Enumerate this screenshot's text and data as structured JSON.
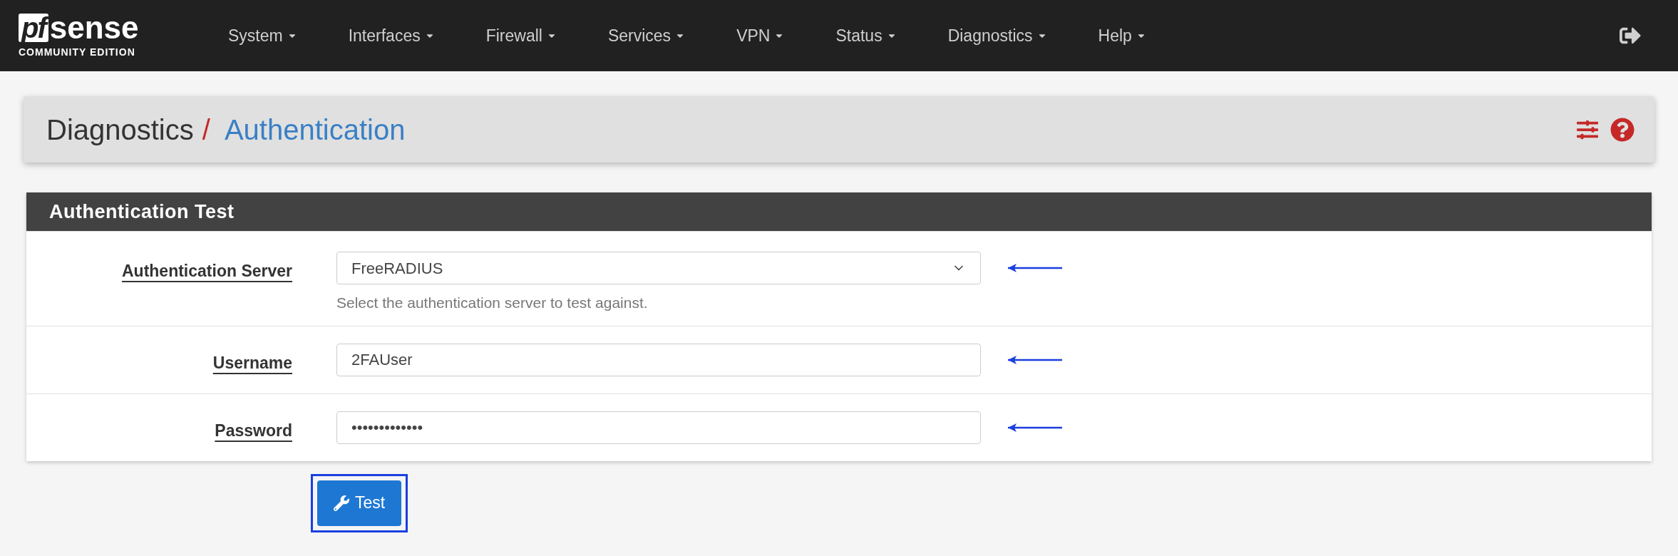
{
  "logo": {
    "mark": "pf",
    "name": "sense",
    "edition": "COMMUNITY EDITION"
  },
  "nav": [
    {
      "label": "System"
    },
    {
      "label": "Interfaces"
    },
    {
      "label": "Firewall"
    },
    {
      "label": "Services"
    },
    {
      "label": "VPN"
    },
    {
      "label": "Status"
    },
    {
      "label": "Diagnostics"
    },
    {
      "label": "Help"
    }
  ],
  "breadcrumb": {
    "parent": "Diagnostics",
    "separator": "/",
    "current": "Authentication"
  },
  "panel": {
    "title": "Authentication Test",
    "fields": [
      {
        "kind": "select",
        "label": "Authentication Server",
        "value": "FreeRADIUS",
        "help": "Select the authentication server to test against.",
        "annotated": true
      },
      {
        "kind": "input",
        "label": "Username",
        "value": "2FAUser",
        "annotated": true
      },
      {
        "kind": "input",
        "label": "Password",
        "value": "•••••••••••••",
        "annotated": true
      }
    ]
  },
  "submit": {
    "label": "Test",
    "highlighted": true
  }
}
